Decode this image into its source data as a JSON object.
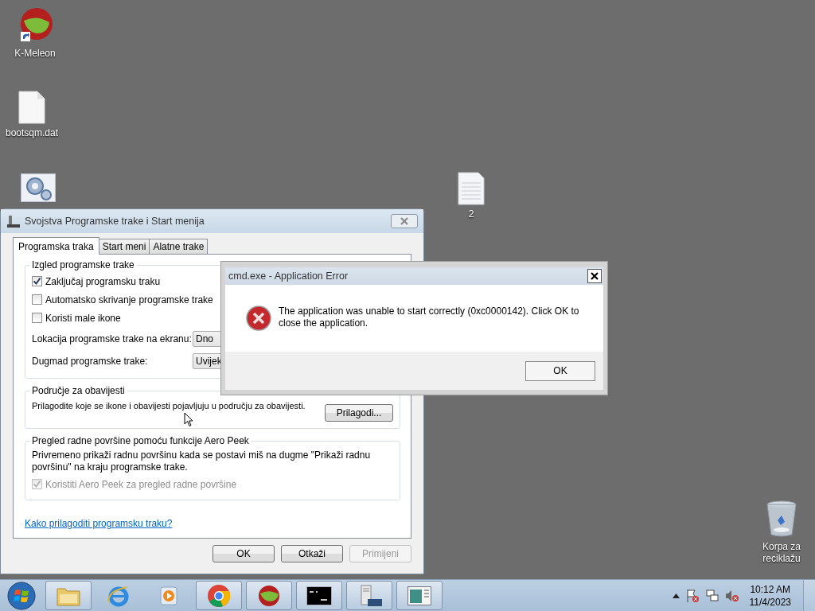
{
  "desktop_icons": [
    {
      "kind": "kmeleon",
      "label": "K-Meleon"
    },
    {
      "kind": "file",
      "label": "bootsqm.dat"
    },
    {
      "kind": "settings"
    },
    {
      "kind": "textfile",
      "label": "2"
    },
    {
      "kind": "recycle",
      "label": "Korpa za reciklažu"
    }
  ],
  "properties_window": {
    "title": "Svojstva Programske trake i Start menija",
    "tabs": [
      {
        "label": "Programska traka",
        "selected": true
      },
      {
        "label": "Start meni",
        "selected": false
      },
      {
        "label": "Alatne trake",
        "selected": false
      }
    ],
    "appearance": {
      "legend": "Izgled programske trake",
      "checkboxes": [
        {
          "label": "Zaključaj programsku traku",
          "checked": true
        },
        {
          "label": "Automatsko skrivanje programske trake",
          "checked": false
        },
        {
          "label": "Koristi male ikone",
          "checked": false
        }
      ],
      "dropdowns": [
        {
          "label": "Lokacija programske trake na ekranu:",
          "value": "Dno"
        },
        {
          "label": "Dugmad programske trake:",
          "value": "Uvijek"
        }
      ]
    },
    "notification": {
      "legend": "Područje za obavijesti",
      "text": "Prilagodite koje se ikone i obavijesti pojavljuju u području za obavijesti.",
      "button": "Prilagodi..."
    },
    "peek": {
      "legend": "Pregled radne površine pomoću funkcije Aero Peek",
      "text": "Privremeno prikaži radnu površinu kada se postavi miš na dugme \"Prikaži radnu površinu\" na kraju programske trake.",
      "checkbox": {
        "label": "Koristiti Aero Peek za pregled radne površine",
        "checked": true,
        "disabled": true
      }
    },
    "link": "Kako prilagoditi programsku traku?",
    "buttons": [
      {
        "label": "OK",
        "disabled": false
      },
      {
        "label": "Otkaži",
        "disabled": false
      },
      {
        "label": "Primijeni",
        "disabled": true
      }
    ]
  },
  "error_dialog": {
    "title": "cmd.exe - Application Error",
    "message": "The application was unable to start correctly (0xc0000142). Click OK to close the application.",
    "button": "OK"
  },
  "taskbar": {
    "items": [
      {
        "kind": "explorer",
        "running": true
      },
      {
        "kind": "ie",
        "running": false
      },
      {
        "kind": "media",
        "running": false
      },
      {
        "kind": "chrome",
        "running": true
      },
      {
        "kind": "kmeleon",
        "running": true
      },
      {
        "kind": "cmd",
        "running": true
      },
      {
        "kind": "server",
        "running": true
      },
      {
        "kind": "window",
        "running": true
      }
    ],
    "clock": {
      "time": "10:12 AM",
      "date": "11/4/2023"
    }
  }
}
